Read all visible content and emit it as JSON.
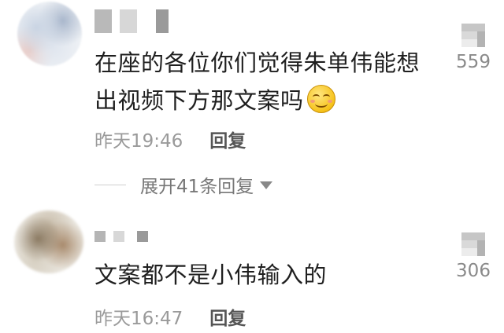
{
  "comments": [
    {
      "text_line1": "在座的各位你们觉得朱单伟能想",
      "text_line2": "出视频下方那文案吗",
      "emoji_icon": "smile-emoji",
      "time": "昨天19:46",
      "reply_label": "回复",
      "likes": "559"
    },
    {
      "text_line1": "文案都不是小伟输入的",
      "time": "昨天16:47",
      "reply_label": "回复",
      "likes": "306"
    }
  ],
  "expand": {
    "label": "展开41条回复",
    "icon": "caret-down-icon"
  },
  "colors": {
    "meta_gray": "#9a9a9a",
    "reply_dark": "#555555",
    "text_dark": "#1f1f1f"
  }
}
